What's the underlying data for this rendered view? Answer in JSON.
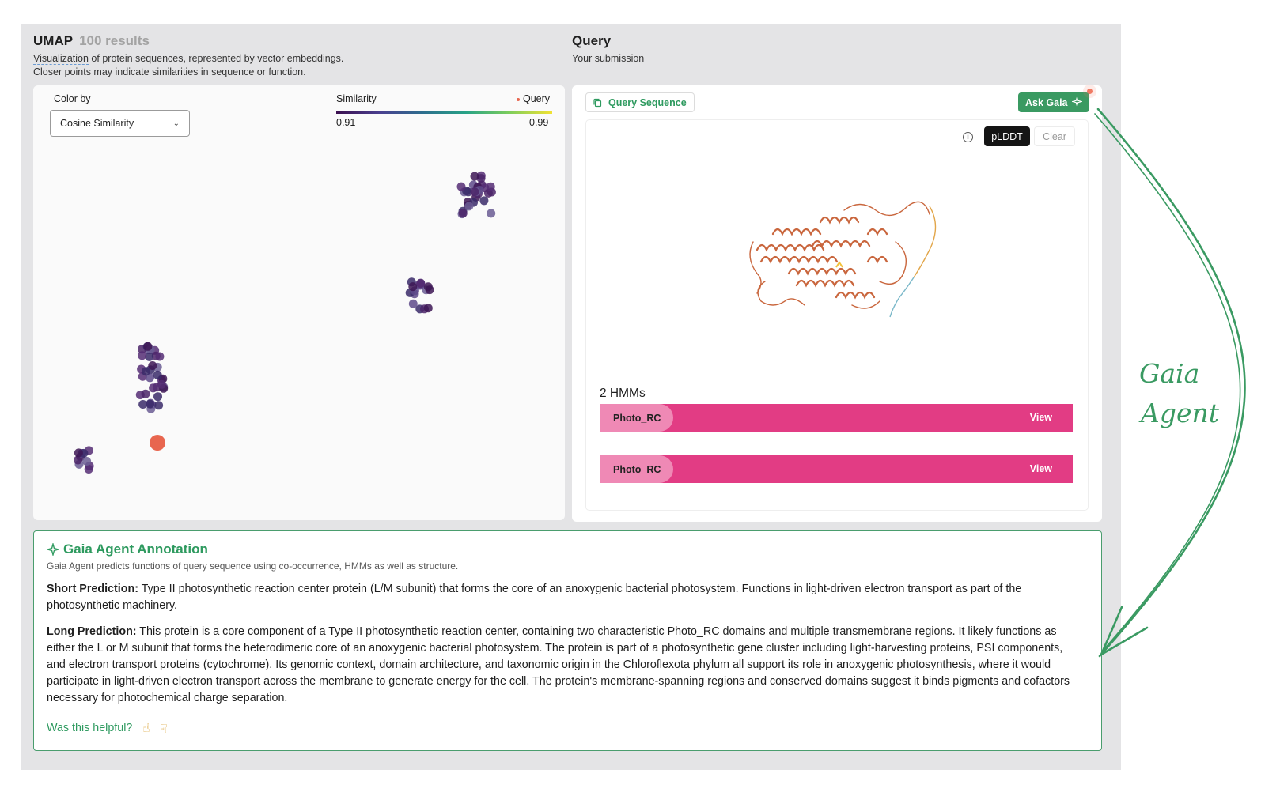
{
  "umap": {
    "title": "UMAP",
    "count": "100 results",
    "desc_link": "Visualization",
    "desc_rest": " of protein sequences, represented by vector embeddings.",
    "desc_line2": "Closer points may indicate similarities in sequence or function.",
    "color_by_label": "Color by",
    "color_by_value": "Cosine Similarity",
    "legend_title": "Similarity",
    "legend_query": "Query",
    "legend_min": "0.91",
    "legend_max": "0.99"
  },
  "query": {
    "title": "Query",
    "subtitle": "Your submission",
    "sequence_button": "Query Sequence",
    "ask_button": "Ask Gaia",
    "plddt_button": "pLDDT",
    "clear_button": "Clear",
    "hmm_count": "2 HMMs",
    "hmms": [
      {
        "name": "Photo_RC",
        "action": "View"
      },
      {
        "name": "Photo_RC",
        "action": "View"
      }
    ]
  },
  "annotation": {
    "title": "Gaia Agent Annotation",
    "subtitle": "Gaia Agent predicts functions of query sequence using co-occurrence, HMMs as well as structure.",
    "short_label": "Short Prediction:",
    "short_text": " Type II photosynthetic reaction center protein (L/M subunit) that forms the core of an anoxygenic bacterial photosystem. Functions in light-driven electron transport as part of the photosynthetic machinery.",
    "long_label": "Long Prediction:",
    "long_text": " This protein is a core component of a Type II photosynthetic reaction center, containing two characteristic Photo_RC domains and multiple transmembrane regions. It likely functions as either the L or M subunit that forms the heterodimeric core of an anoxygenic bacterial photosystem. The protein is part of a photosynthetic gene cluster including light-harvesting proteins, PSI components, and electron transport proteins (cytochrome). Its genomic context, domain architecture, and taxonomic origin in the Chloroflexota phylum all support its role in anoxygenic photosynthesis, where it would participate in light-driven electron transport across the membrane to generate energy for the cell. The protein's membrane-spanning regions and conserved domains suggest it binds pigments and cofactors necessary for photochemical charge separation.",
    "helpful": "Was this helpful?"
  },
  "handwritten": {
    "line1": "Gaia",
    "line2": "Agent"
  },
  "colors": {
    "accent_green": "#3a9a62",
    "hmm_bar": "#e23c84",
    "hmm_pill": "#ef89b5",
    "query_point": "#e8664f",
    "cluster_point": "#4e2a6e"
  },
  "icons": {
    "copy": "copy-icon",
    "sparkle": "sparkle-icon",
    "info": "info-icon",
    "chevron": "chevron-down-icon",
    "thumbs_up": "thumbs-up-icon",
    "thumbs_down": "thumbs-down-icon"
  }
}
